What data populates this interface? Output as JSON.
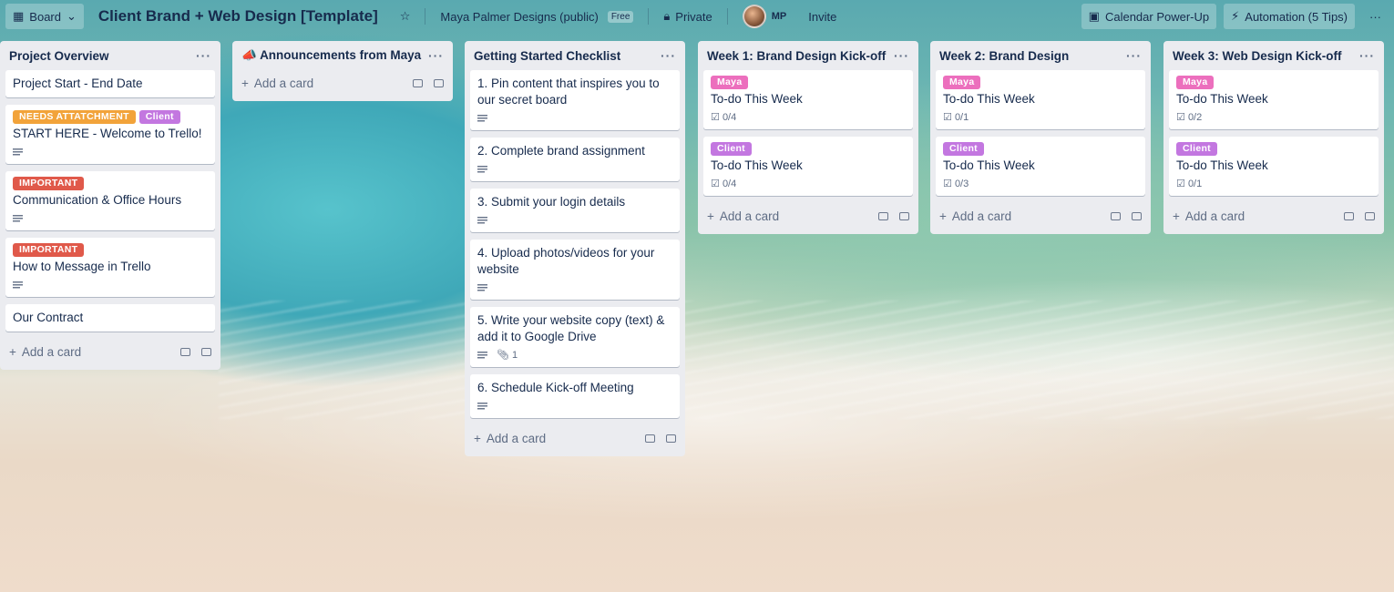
{
  "header": {
    "board_view": "Board",
    "title": "Client Brand + Web Design [Template]",
    "workspace": "Maya Palmer Designs (public)",
    "plan_badge": "Free",
    "visibility": "Private",
    "member_initials": "MP",
    "invite": "Invite",
    "calendar": "Calendar Power-Up",
    "automation": "Automation (5 Tips)"
  },
  "add_card_label": "Add a card",
  "lists": [
    {
      "title": "Project Overview",
      "cards": [
        {
          "title": "Project Start - End Date"
        },
        {
          "labels": [
            "NEEDS ATTATCHMENT",
            "Client"
          ],
          "title": "START HERE - Welcome to Trello!"
        },
        {
          "labels": [
            "IMPORTANT"
          ],
          "title": "Communication & Office Hours"
        },
        {
          "labels": [
            "IMPORTANT"
          ],
          "title": "How to Message in Trello"
        },
        {
          "title": "Our Contract"
        }
      ]
    },
    {
      "title": "Announcements from Maya",
      "emoji": "📣",
      "cards": []
    },
    {
      "title": "Getting Started Checklist",
      "cards": [
        {
          "title": "1. Pin content that inspires you to our secret board"
        },
        {
          "title": "2. Complete brand assignment"
        },
        {
          "title": "3. Submit your login details"
        },
        {
          "title": "4. Upload photos/videos for your website"
        },
        {
          "title": "5. Write your website copy (text) & add it to Google Drive",
          "attachments": "1"
        },
        {
          "title": "6. Schedule Kick-off Meeting"
        }
      ]
    },
    {
      "title": "Week 1: Brand Design Kick-off",
      "cards": [
        {
          "labels": [
            "Maya"
          ],
          "title": "To-do This Week",
          "checklist": "0/4"
        },
        {
          "labels": [
            "Client"
          ],
          "title": "To-do This Week",
          "checklist": "0/4"
        }
      ]
    },
    {
      "title": "Week 2: Brand Design",
      "cards": [
        {
          "labels": [
            "Maya"
          ],
          "title": "To-do This Week",
          "checklist": "0/1"
        },
        {
          "labels": [
            "Client"
          ],
          "title": "To-do This Week",
          "checklist": "0/3"
        }
      ]
    },
    {
      "title": "Week 3: Web Design Kick-off",
      "cards": [
        {
          "labels": [
            "Maya"
          ],
          "title": "To-do This Week",
          "checklist": "0/2"
        },
        {
          "labels": [
            "Client"
          ],
          "title": "To-do This Week",
          "checklist": "0/1"
        }
      ]
    }
  ],
  "colors": {
    "label_orange": "#f2a33a",
    "label_purple": "#c377e0",
    "label_red": "#e0594a",
    "label_pink": "#ec6fbd",
    "list_bg": "#ebecf0"
  }
}
